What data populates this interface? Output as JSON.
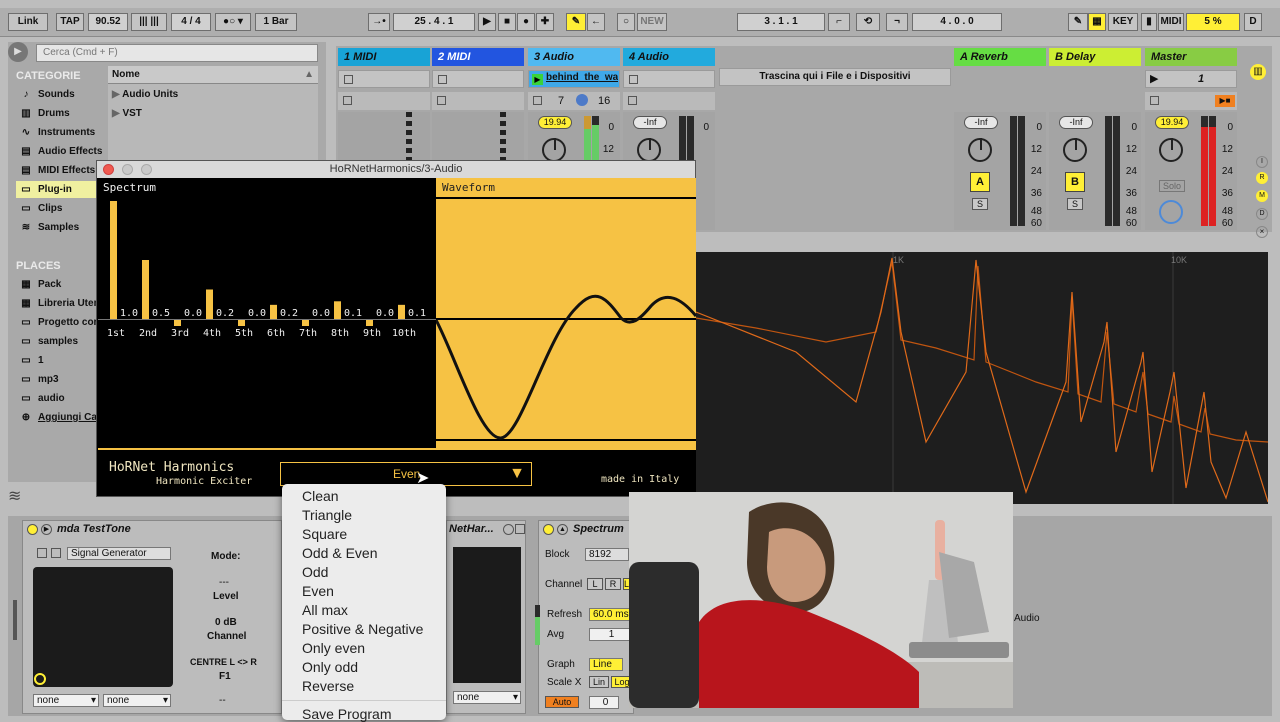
{
  "topbar": {
    "link": "Link",
    "tap": "TAP",
    "tempo": "90.52",
    "signature": "4 / 4",
    "quant": "1 Bar",
    "position": "25 .  4 .  1",
    "new": "NEW",
    "loop_start": "3 .  1 .  1",
    "loop_length": "4 .  0 .  0",
    "key": "KEY",
    "midi": "MIDI",
    "cpu": "5 %",
    "d": "D"
  },
  "browser": {
    "search_placeholder": "Cerca (Cmd + F)",
    "categories_title": "CATEGORIE",
    "categories": [
      "Sounds",
      "Drums",
      "Instruments",
      "Audio Effects",
      "MIDI Effects",
      "Plug-in",
      "Clips",
      "Samples"
    ],
    "places_title": "PLACES",
    "places": [
      "Pack",
      "Libreria Utente",
      "Progetto corrente",
      "samples",
      "1",
      "mp3",
      "audio",
      "Aggiungi Cartella"
    ],
    "name_header": "Nome",
    "items": [
      "Audio Units",
      "VST"
    ]
  },
  "session": {
    "tracks": [
      {
        "name": "1 MIDI",
        "color": "#18a3d6"
      },
      {
        "name": "2 MIDI",
        "color": "#2255e0"
      },
      {
        "name": "3 Audio",
        "color": "#50b9f0"
      },
      {
        "name": "4 Audio",
        "color": "#22aadd"
      },
      {
        "name": "A Reverb",
        "color": "#66dd44"
      },
      {
        "name": "B Delay",
        "color": "#ccee33"
      },
      {
        "name": "Master",
        "color": "#88cc44"
      }
    ],
    "clip_name": "behind_the_wall",
    "drop_hint": "Trascina qui i File e i Dispositivi",
    "track3_in": "7",
    "track3_out": "16",
    "master_num": "1",
    "vol3": "19.94",
    "vol4": "-Inf",
    "volA": "-Inf",
    "volB": "-Inf",
    "volM": "19.94",
    "sendA": "A",
    "sendB": "B",
    "solo": "S",
    "solo_label": "Solo",
    "scale": [
      "0",
      "12",
      "24",
      "36",
      "48",
      "60"
    ]
  },
  "analyzer": {
    "label_1k": "1K",
    "label_10k": "10K"
  },
  "plugin": {
    "window_title": "HoRNetHarmonics/3-Audio",
    "spectrum_label": "Spectrum",
    "waveform_label": "Waveform",
    "harmonics": [
      {
        "label": "1st",
        "value": "1.0",
        "level": 1.0
      },
      {
        "label": "2nd",
        "value": "0.5",
        "level": 0.5
      },
      {
        "label": "3rd",
        "value": "0.0",
        "level": 0.0
      },
      {
        "label": "4th",
        "value": "0.2",
        "level": 0.25
      },
      {
        "label": "5th",
        "value": "0.0",
        "level": 0.0
      },
      {
        "label": "6th",
        "value": "0.2",
        "level": 0.12
      },
      {
        "label": "7th",
        "value": "0.0",
        "level": 0.0
      },
      {
        "label": "8th",
        "value": "0.1",
        "level": 0.15
      },
      {
        "label": "9th",
        "value": "0.0",
        "level": 0.0
      },
      {
        "label": "10th",
        "value": "0.1",
        "level": 0.12
      }
    ],
    "brand": "HoRNet Harmonics",
    "subtitle": "Harmonic Exciter",
    "selected_mode": "Even",
    "made_in": "made in Italy"
  },
  "menu": {
    "items": [
      "Clean",
      "Triangle",
      "Square",
      "Odd & Even",
      "Odd",
      "Even",
      "All max",
      "Positive & Negative",
      "Only even",
      "Only odd",
      "Reverse"
    ],
    "save": "Save Program"
  },
  "devices": {
    "testtone_title": "mda TestTone",
    "generator": "Signal Generator",
    "mode_label": "Mode:",
    "mode_value": "---",
    "level_label": "Level",
    "level_value": "0 dB",
    "channel_label": "Channel",
    "channel_value": "CENTRE L <> R",
    "f1_label": "F1",
    "f1_value": "--",
    "none1": "none",
    "none2": "none",
    "none3": "none",
    "hornet_title": "NetHar...",
    "spectrum_title": "Spectrum",
    "block_label": "Block",
    "block_value": "8192",
    "channel2_label": "Channel",
    "ch_l": "L",
    "ch_r": "R",
    "ch_lr": "L+R",
    "refresh_label": "Refresh",
    "refresh_value": "60.0 ms",
    "avg_label": "Avg",
    "avg_value": "1",
    "graph_label": "Graph",
    "graph_value": "Line",
    "scalex_label": "Scale X",
    "lin": "Lin",
    "log": "Log",
    "auto": "Auto",
    "zero": "0",
    "audio_label": "Audio"
  }
}
